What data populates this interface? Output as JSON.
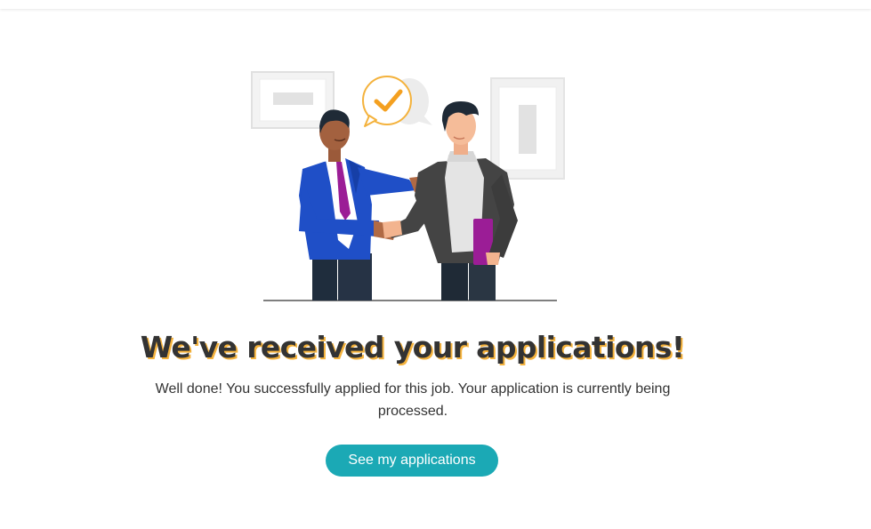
{
  "success": {
    "headline": "We've received your applications!",
    "message": "Well done! You successfully applied for this job. Your application is currently being processed.",
    "cta_label": "See my applications"
  },
  "illustration": {
    "icon": "handshake-illustration",
    "badge_icon": "checkmark-icon"
  },
  "colors": {
    "accent": "#1ba9b5",
    "headline_shadow": "#f4b23c",
    "text": "#333333",
    "suit_blue": "#1f4fc7",
    "tie_purple": "#9b1d96"
  }
}
